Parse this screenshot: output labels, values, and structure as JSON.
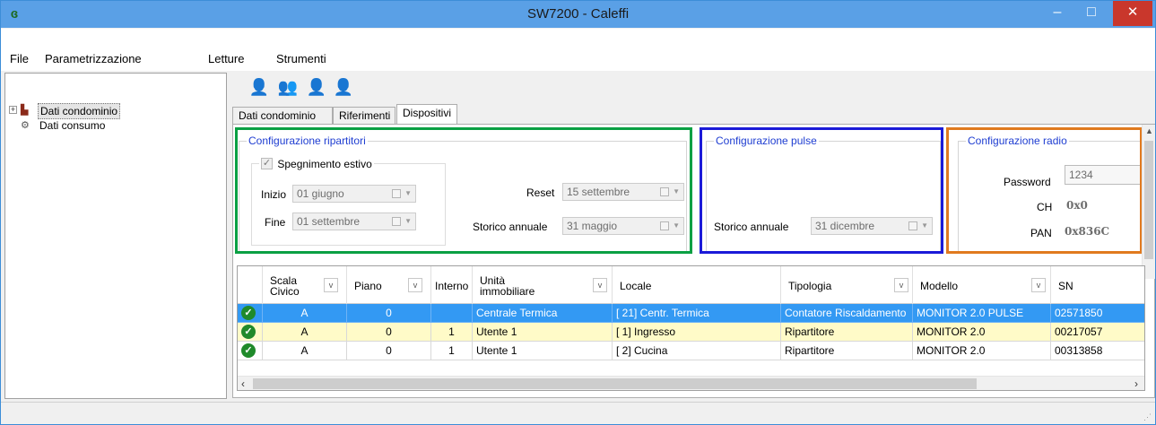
{
  "window": {
    "title": "SW7200 - Caleffi",
    "app_icon": "caleffi-logo-icon",
    "controls": {
      "minimize": "–",
      "maximize": "□",
      "close": "✕"
    }
  },
  "menu": [
    "File",
    "Parametrizzazione",
    "Letture",
    "Strumenti"
  ],
  "tree": [
    {
      "label": "Dati condominio",
      "icon": "building-icon",
      "expanded": false,
      "selected": true
    },
    {
      "label": "Dati consumo",
      "icon": "gears-icon",
      "selected": false
    }
  ],
  "toolbar": {
    "buttons": [
      "add-user-icon",
      "users-icon",
      "user-move-icon",
      "user-remove-icon"
    ]
  },
  "tabs": [
    "Dati condominio",
    "Riferimenti",
    "Dispositivi"
  ],
  "active_tab": "Dispositivi",
  "ripartitori": {
    "title": "Configurazione ripartitori",
    "summer_off": {
      "label": "Spegnimento estivo",
      "checked": true
    },
    "inizio_label": "Inizio",
    "inizio_value": "01  giugno",
    "fine_label": "Fine",
    "fine_value": "01 settembre",
    "reset_label": "Reset",
    "reset_value": "15 settembre",
    "storico_label": "Storico annuale",
    "storico_value": "31  maggio"
  },
  "pulse": {
    "title": "Configurazione pulse",
    "storico_label": "Storico annuale",
    "storico_value": "31  dicembre"
  },
  "radio": {
    "title": "Configurazione radio",
    "password_label": "Password",
    "password_value": "1234",
    "ch_label": "CH",
    "ch_value": "0x0",
    "pan_label": "PAN",
    "pan_value": "0x836C"
  },
  "highlight_colors": {
    "ripartitori": "#0aa043",
    "pulse": "#1b1ad8",
    "radio": "#e07a1f"
  },
  "grid": {
    "headers": [
      "Scala Civico",
      "Piano",
      "Interno",
      "Unità immobiliare",
      "Locale",
      "Tipologia",
      "Modello",
      "SN"
    ],
    "header_lines": {
      "scala": [
        "Scala",
        "Civico"
      ],
      "unita": [
        "Unità",
        "immobiliare"
      ]
    },
    "rows": [
      {
        "status": "ok",
        "scala": "A",
        "piano": "0",
        "interno": "",
        "unita": "Centrale Termica",
        "locale": "[ 21] Centr. Termica",
        "tipologia": "Contatore Riscaldamento",
        "modello": "MONITOR 2.0 PULSE",
        "sn": "02571850",
        "style": "selected"
      },
      {
        "status": "ok",
        "scala": "A",
        "piano": "0",
        "interno": "1",
        "unita": "Utente 1",
        "locale": "[  1] Ingresso",
        "tipologia": "Ripartitore",
        "modello": "MONITOR 2.0",
        "sn": "00217057",
        "style": "highlight"
      },
      {
        "status": "ok",
        "scala": "A",
        "piano": "0",
        "interno": "1",
        "unita": "Utente 1",
        "locale": "[  2] Cucina",
        "tipologia": "Ripartitore",
        "modello": "MONITOR 2.0",
        "sn": "00313858",
        "style": "normal"
      }
    ],
    "row_colors": {
      "selected": "#3399f3",
      "highlight": "#fffbc8",
      "normal": "#ffffff"
    }
  }
}
